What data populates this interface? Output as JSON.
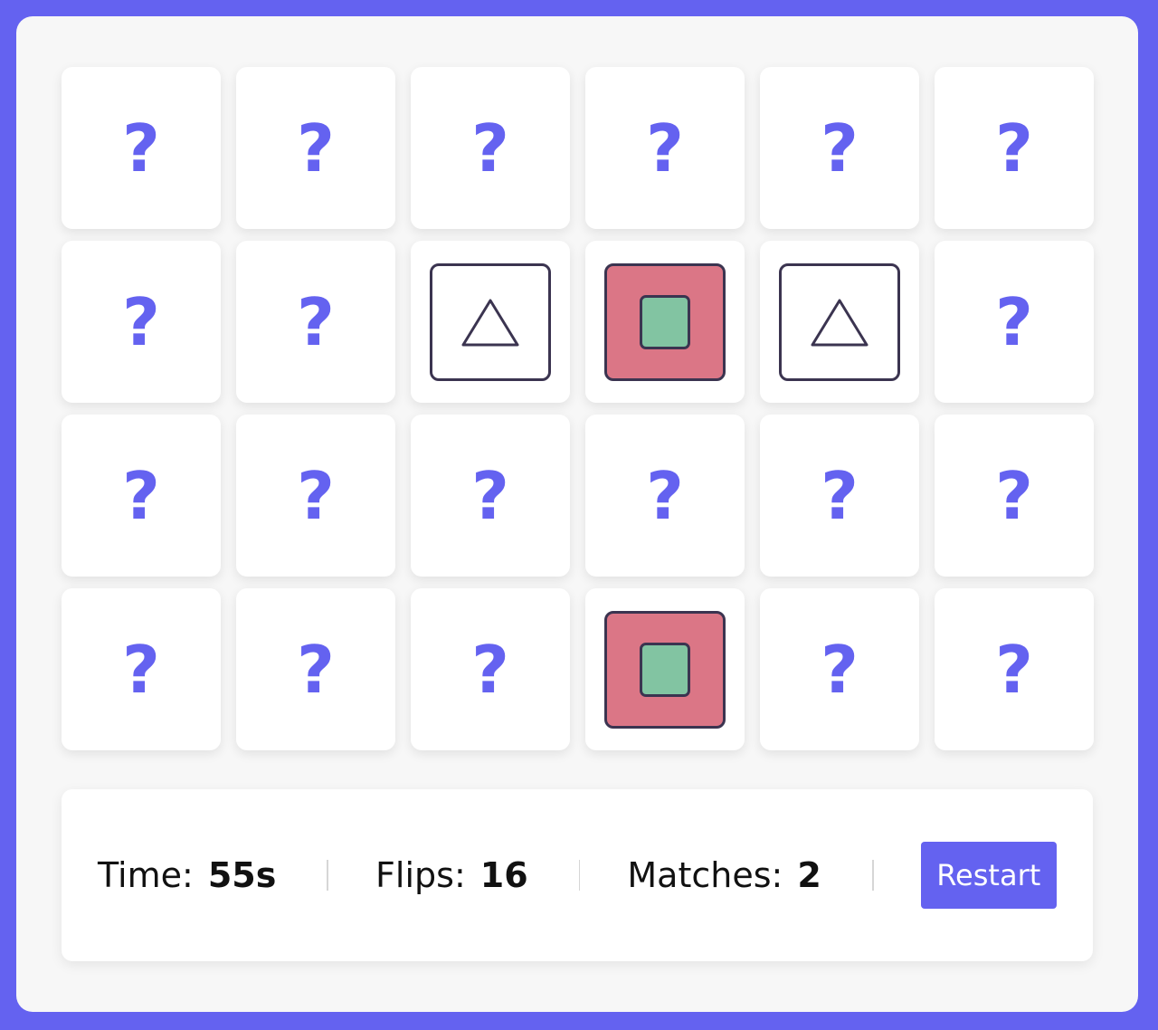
{
  "colors": {
    "accent": "#6462f0",
    "panel": "#f7f7f7",
    "card": "#ffffff",
    "card_red": "#db7686",
    "card_green": "#82c4a2",
    "outline": "#3b3450"
  },
  "board": {
    "rows": 4,
    "columns": 6,
    "hidden_symbol": "?",
    "cards": [
      {
        "state": "hidden"
      },
      {
        "state": "hidden"
      },
      {
        "state": "hidden"
      },
      {
        "state": "hidden"
      },
      {
        "state": "hidden"
      },
      {
        "state": "hidden"
      },
      {
        "state": "hidden"
      },
      {
        "state": "hidden"
      },
      {
        "state": "revealed",
        "symbol": "triangle-icon"
      },
      {
        "state": "matched",
        "symbol": "green-square-on-red-icon"
      },
      {
        "state": "revealed",
        "symbol": "triangle-icon"
      },
      {
        "state": "hidden"
      },
      {
        "state": "hidden"
      },
      {
        "state": "hidden"
      },
      {
        "state": "hidden"
      },
      {
        "state": "hidden"
      },
      {
        "state": "hidden"
      },
      {
        "state": "hidden"
      },
      {
        "state": "hidden"
      },
      {
        "state": "hidden"
      },
      {
        "state": "hidden"
      },
      {
        "state": "matched",
        "symbol": "green-square-on-red-icon"
      },
      {
        "state": "hidden"
      },
      {
        "state": "hidden"
      }
    ]
  },
  "stats": {
    "time_label": "Time:",
    "time_value": "55s",
    "flips_label": "Flips:",
    "flips_value": "16",
    "matches_label": "Matches:",
    "matches_value": "2"
  },
  "controls": {
    "restart_label": "Restart"
  }
}
